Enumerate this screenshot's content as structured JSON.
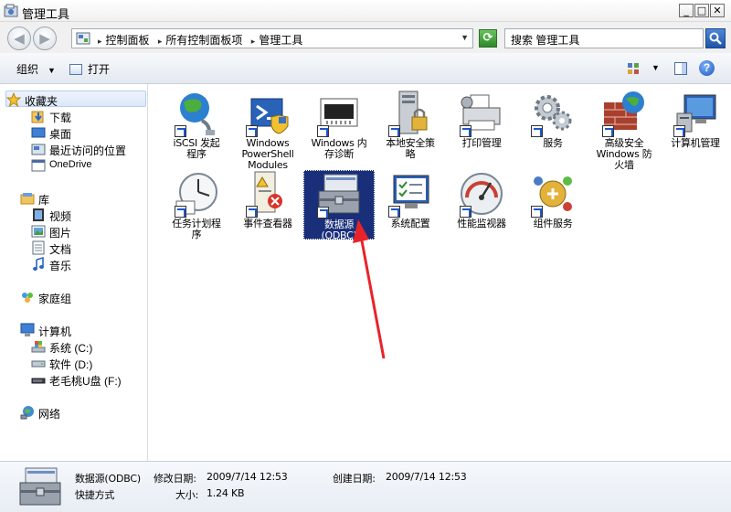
{
  "window": {
    "title": "管理工具",
    "min": "_",
    "max": "□",
    "close": "✕"
  },
  "address": {
    "crumbs": [
      "控制面板",
      "所有控制面板项",
      "管理工具"
    ],
    "search_placeholder": "搜索 管理工具"
  },
  "toolbar": {
    "organize": "组织",
    "open": "打开"
  },
  "nav": {
    "favorites": "收藏夹",
    "favorites_items": [
      "下载",
      "桌面",
      "最近访问的位置",
      "OneDrive"
    ],
    "libraries": "库",
    "libraries_items": [
      "视频",
      "图片",
      "文档",
      "音乐"
    ],
    "homegroup": "家庭组",
    "computer": "计算机",
    "computer_items": [
      "系统 (C:)",
      "软件 (D:)",
      "老毛桃U盘 (F:)"
    ],
    "network": "网络"
  },
  "items": [
    [
      "iSCSI 发起",
      "程序"
    ],
    [
      "Windows",
      "PowerShell",
      "Modules"
    ],
    [
      "Windows 内",
      "存诊断"
    ],
    [
      "本地安全策",
      "略"
    ],
    [
      "打印管理"
    ],
    [
      "服务"
    ],
    [
      "高级安全",
      "Windows 防",
      "火墙"
    ],
    [
      "计算机管理"
    ],
    [
      "任务计划程",
      "序"
    ],
    [
      "事件查看器"
    ],
    [
      "数据源",
      "(ODBC)"
    ],
    [
      "系统配置"
    ],
    [
      "性能监视器"
    ],
    [
      "组件服务"
    ]
  ],
  "details": {
    "name": "数据源(ODBC)",
    "type": "快捷方式",
    "modified_label": "修改日期:",
    "modified": "2009/7/14 12:53",
    "created_label": "创建日期:",
    "created": "2009/7/14 12:53",
    "size_label": "大小:",
    "size": "1.24 KB"
  },
  "colors": {
    "selection": "#1a2f7a",
    "arrow": "#e8232a",
    "accent": "#1d57c8"
  }
}
